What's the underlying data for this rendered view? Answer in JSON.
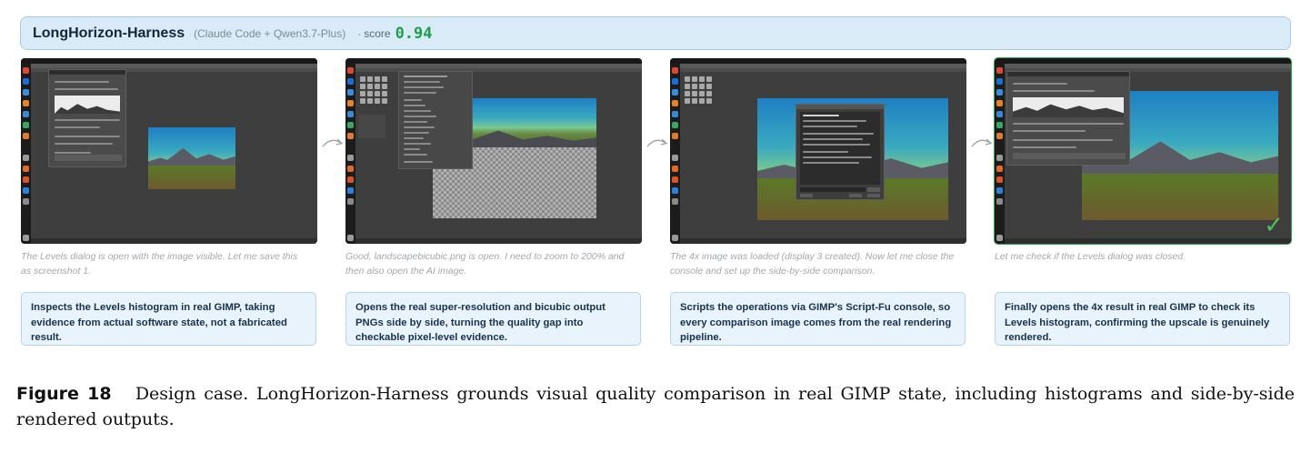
{
  "header": {
    "title": "LongHorizon-Harness",
    "subtitle": "(Claude Code + Qwen3.7-Plus)",
    "separator": "·",
    "score_label": "score",
    "score_value": "0.94"
  },
  "colors": {
    "header_bg": "#d9ebf7",
    "score": "#1f9e4f",
    "card_bg": "#e8f3fb",
    "success_border": "#2fa84f"
  },
  "panels": [
    {
      "caption": "The Levels dialog is open with the image visible. Let me save this as screenshot 1.",
      "summary": "Inspects the Levels histogram in real GIMP, taking evidence from actual software state, not a fabricated result."
    },
    {
      "caption": "Good, landscapebicubic.png is open. I need to zoom to 200% and then also open the AI image.",
      "summary": "Opens the real super-resolution and bicubic output PNGs side by side, turning the quality gap into checkable pixel-level evidence."
    },
    {
      "caption": "The 4x image was loaded (display 3 created). Now let me close the console and set up the side-by-side comparison.",
      "summary": "Scripts the operations via GIMP's Script-Fu console, so every comparison image comes from the real rendering pipeline."
    },
    {
      "caption": "Let me check if the Levels dialog was closed.",
      "summary": "Finally opens the 4x result in real GIMP to check its Levels histogram, confirming the upscale is genuinely rendered."
    }
  ],
  "figure": {
    "label": "Figure 18",
    "text": "Design case. LongHorizon-Harness grounds visual quality comparison in real GIMP state, including histograms and side-by-side rendered outputs."
  }
}
